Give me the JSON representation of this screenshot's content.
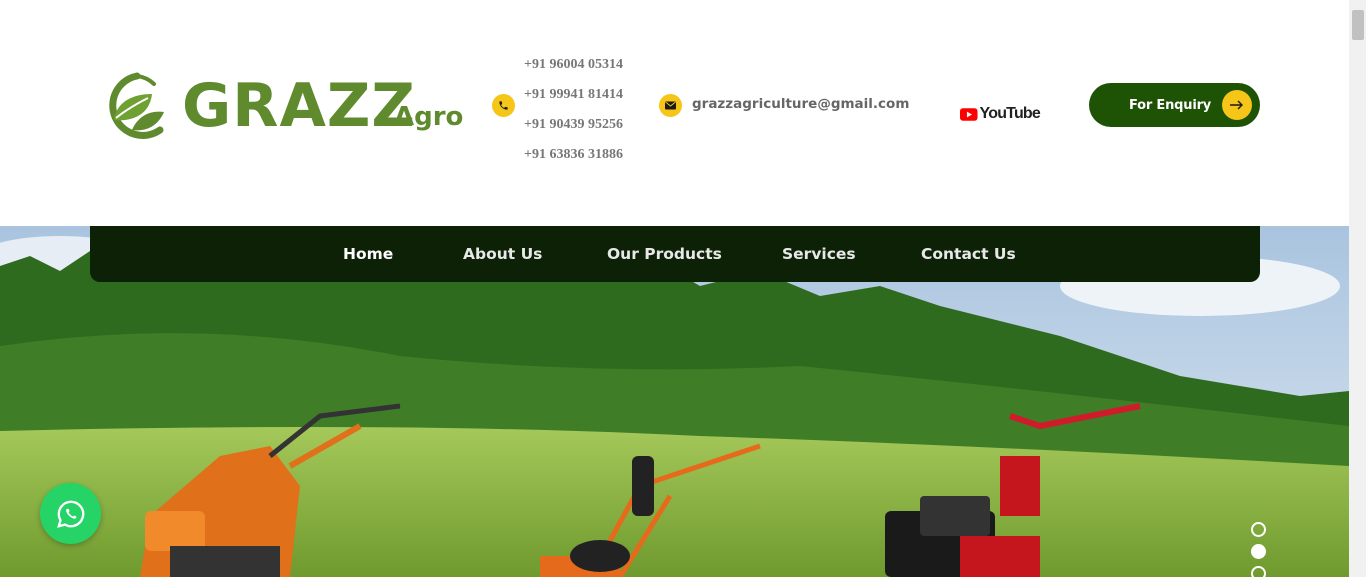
{
  "header": {
    "logo": {
      "brand": "GRAZZ",
      "sub": "Agro"
    },
    "phones": [
      "+91 96004 05314",
      "+91 99941 81414",
      "+91 90439 95256",
      "+91 63836 31886"
    ],
    "email": "grazzagriculture@gmail.com",
    "youtube_label": "YouTube",
    "enquiry_label": "For Enquiry"
  },
  "nav": {
    "items": [
      {
        "label": "Home",
        "active": true
      },
      {
        "label": "About Us"
      },
      {
        "label": "Our Products"
      },
      {
        "label": "Services"
      },
      {
        "label": "Contact Us"
      }
    ]
  },
  "slider": {
    "dots": 3,
    "active_index": 1
  },
  "icons": [
    "phone-icon",
    "mail-icon",
    "youtube-play-icon",
    "arrow-right-icon",
    "whatsapp-icon",
    "leaf-icon"
  ],
  "colors": {
    "brand_green": "#5f8a2e",
    "dark_green": "#1e5306",
    "nav_bg": "#0d2106",
    "accent_yellow": "#f5c518",
    "whatsapp_green": "#25d366",
    "youtube_red": "#ff0000"
  }
}
